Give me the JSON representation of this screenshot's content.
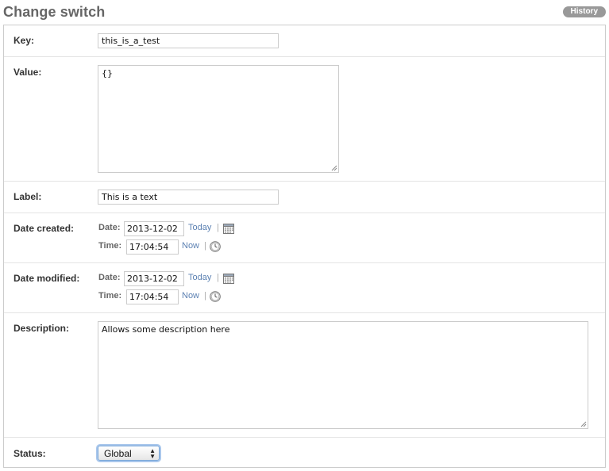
{
  "header": {
    "title": "Change switch",
    "history_label": "History"
  },
  "fields": {
    "key": {
      "label": "Key:",
      "value": "this_is_a_test"
    },
    "value": {
      "label": "Value:",
      "value": "{}"
    },
    "label": {
      "label": "Label:",
      "value": "This is a text"
    },
    "date_created": {
      "label": "Date created:",
      "date_label": "Date:",
      "date_value": "2013-12-02",
      "today_label": "Today",
      "time_label": "Time:",
      "time_value": "17:04:54",
      "now_label": "Now",
      "separator": "|"
    },
    "date_modified": {
      "label": "Date modified:",
      "date_label": "Date:",
      "date_value": "2013-12-02",
      "today_label": "Today",
      "time_label": "Time:",
      "time_value": "17:04:54",
      "now_label": "Now",
      "separator": "|"
    },
    "description": {
      "label": "Description:",
      "value": "Allows some description here"
    },
    "status": {
      "label": "Status:",
      "selected": "Global"
    }
  },
  "icons": {
    "calendar": "calendar-icon",
    "clock": "clock-icon"
  },
  "colors": {
    "link": "#5b80b2",
    "history_button": "#999999",
    "title": "#666666"
  }
}
